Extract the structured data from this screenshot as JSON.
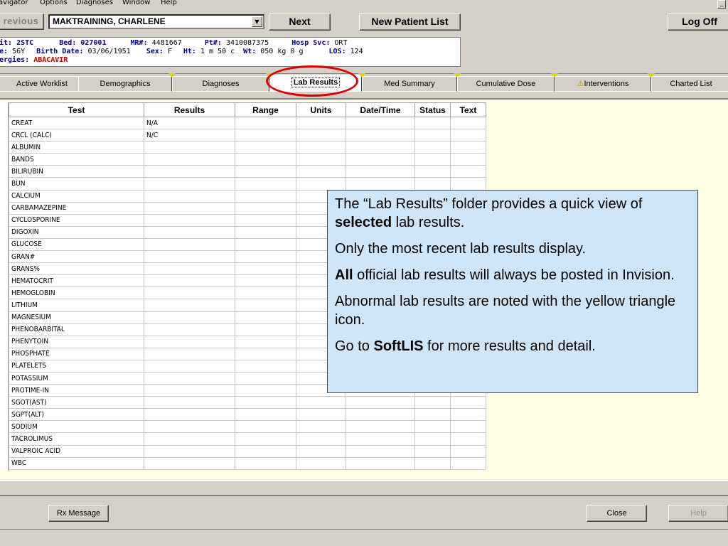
{
  "menu": {
    "items": [
      "avigator",
      "Options",
      "Diagnoses",
      "Window",
      "Help"
    ]
  },
  "toolbar": {
    "previous_label": "revious",
    "patient_name": "MAKTRAINING, CHARLENE",
    "next_label": "Next",
    "new_patient_list_label": "New Patient List",
    "log_off_label": "Log Off"
  },
  "patient": {
    "unit_label": "it:",
    "unit": "2STC",
    "bed_label": "Bed:",
    "bed": "027001",
    "mr_label": "MR#:",
    "mr": "4481667",
    "pt_label": "Pt#:",
    "pt": "3410087375",
    "hosp_svc_label": "Hosp Svc:",
    "hosp_svc": "ORT",
    "age_label": "e:",
    "age": "56Y",
    "birth_label": "Birth Date:",
    "birth_date": "03/06/1951",
    "sex_label": "Sex:",
    "sex": "F",
    "ht_label": "Ht:",
    "ht": "1 m 50 c",
    "wt_label": "Wt:",
    "wt": "050 kg 0 g",
    "los_label": "LOS:",
    "los": "124",
    "allergies_label": "ergies:",
    "allergies": "ABACAVIR"
  },
  "tabs": [
    {
      "label": "Active Worklist"
    },
    {
      "label": "Demographics"
    },
    {
      "label": "Diagnoses"
    },
    {
      "label": "Lab Results"
    },
    {
      "label": "Med Summary"
    },
    {
      "label": "Cumulative Dose"
    },
    {
      "label": "Interventions"
    },
    {
      "label": "Charted List"
    }
  ],
  "table": {
    "headers": [
      "Test",
      "Results",
      "Range",
      "Units",
      "Date/Time",
      "Status",
      "Text"
    ],
    "rows": [
      {
        "test": "CREAT",
        "result": "N/A"
      },
      {
        "test": "CRCL (CALC)",
        "result": "N/C"
      },
      {
        "test": "ALBUMIN",
        "result": ""
      },
      {
        "test": "BANDS",
        "result": ""
      },
      {
        "test": "BILIRUBIN",
        "result": ""
      },
      {
        "test": "BUN",
        "result": ""
      },
      {
        "test": "CALCIUM",
        "result": ""
      },
      {
        "test": "CARBAMAZEPINE",
        "result": ""
      },
      {
        "test": "CYCLOSPORINE",
        "result": ""
      },
      {
        "test": "DIGOXIN",
        "result": ""
      },
      {
        "test": "GLUCOSE",
        "result": ""
      },
      {
        "test": "GRAN#",
        "result": ""
      },
      {
        "test": "GRANS%",
        "result": ""
      },
      {
        "test": "HEMATOCRIT",
        "result": ""
      },
      {
        "test": "HEMOGLOBIN",
        "result": ""
      },
      {
        "test": "LITHIUM",
        "result": ""
      },
      {
        "test": "MAGNESIUM",
        "result": ""
      },
      {
        "test": "PHENOBARBITAL",
        "result": ""
      },
      {
        "test": "PHENYTOIN",
        "result": ""
      },
      {
        "test": "PHOSPHATE",
        "result": ""
      },
      {
        "test": "PLATELETS",
        "result": ""
      },
      {
        "test": "POTASSIUM",
        "result": ""
      },
      {
        "test": "PROTIME-IN",
        "result": ""
      },
      {
        "test": "SGOT(AST)",
        "result": ""
      },
      {
        "test": "SGPT(ALT)",
        "result": ""
      },
      {
        "test": "SODIUM",
        "result": ""
      },
      {
        "test": "TACROLIMUS",
        "result": ""
      },
      {
        "test": "VALPROIC ACID",
        "result": ""
      },
      {
        "test": "WBC",
        "result": ""
      }
    ]
  },
  "callout": {
    "p1_a": "The “Lab Results” folder provides a quick view of ",
    "p1_b": "selected",
    "p1_c": " lab results.",
    "p2": "Only the most recent lab results display.",
    "p3_a": "All",
    "p3_b": " official lab results will always be posted in Invision.",
    "p4": "Abnormal lab results are noted with the yellow triangle icon.",
    "p5_a": "Go to ",
    "p5_b": "SoftLIS",
    "p5_c": " for more results and detail."
  },
  "footer": {
    "rx_message_label": "Rx Message",
    "close_label": "Close",
    "help_label": "Help"
  },
  "colors": {
    "callout_bg": "#cfe6f8",
    "content_bg": "#ffffe8",
    "highlight": "#e00000",
    "allergy": "#c00000"
  }
}
